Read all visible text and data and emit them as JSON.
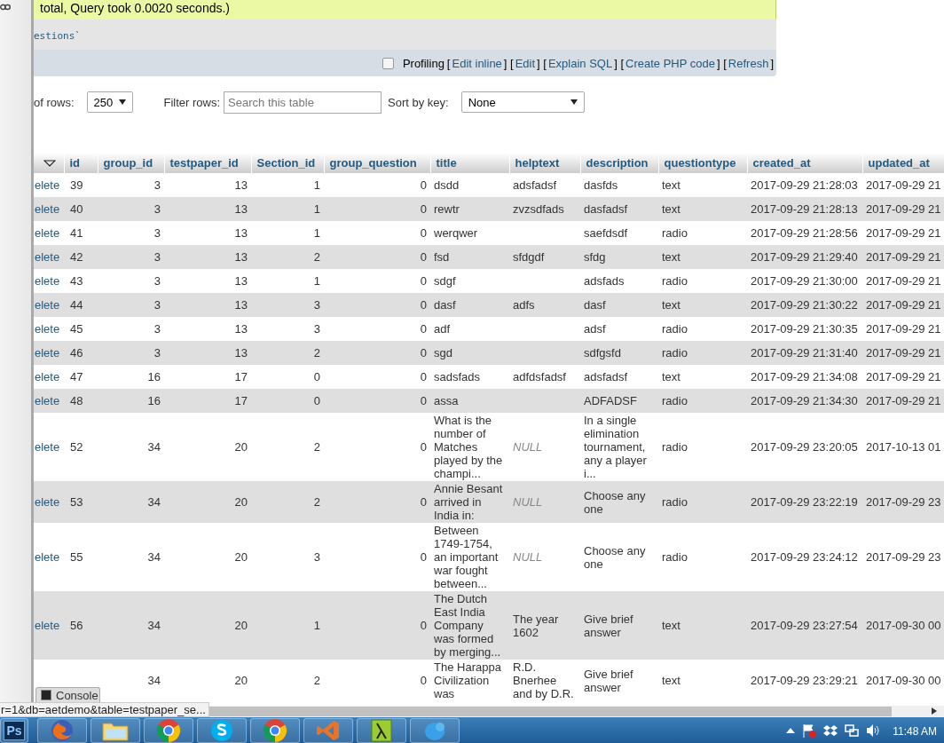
{
  "query_message": "total, Query took 0.0020 seconds.)",
  "sql_fragment": "estions`",
  "toolbar": {
    "profiling": {
      "label": "Profiling",
      "checked": false
    },
    "actions": [
      {
        "kind": "bracket",
        "text": "["
      },
      {
        "kind": "link",
        "text": "Edit inline"
      },
      {
        "kind": "bracket",
        "text": "] ["
      },
      {
        "kind": "link",
        "text": "Edit"
      },
      {
        "kind": "bracket",
        "text": "] ["
      },
      {
        "kind": "link",
        "text": "Explain SQL"
      },
      {
        "kind": "bracket",
        "text": "] ["
      },
      {
        "kind": "link",
        "text": "Create PHP code"
      },
      {
        "kind": "bracket",
        "text": "] ["
      },
      {
        "kind": "link",
        "text": "Refresh"
      },
      {
        "kind": "bracket",
        "text": "]"
      }
    ]
  },
  "controls": {
    "rows_label": "of rows:",
    "rows_value": "250",
    "filter_label": "Filter rows:",
    "filter_placeholder": "Search this table",
    "sort_label": "Sort by key:",
    "sort_value": "None"
  },
  "table": {
    "columns": [
      {
        "label": "id"
      },
      {
        "label": "group_id"
      },
      {
        "label": "testpaper_id"
      },
      {
        "label": "Section_id"
      },
      {
        "label": "group_question"
      },
      {
        "label": "title"
      },
      {
        "label": "helptext"
      },
      {
        "label": "description"
      },
      {
        "label": "questiontype"
      },
      {
        "label": "created_at"
      },
      {
        "label": "updated_at"
      }
    ],
    "rows": [
      {
        "action": "elete",
        "cells": [
          "39",
          "3",
          "13",
          "1",
          "0",
          "dsdd",
          "adsfadsf",
          "dasfds",
          "text",
          "2017-09-29 21:28:03",
          "2017-09-29 21"
        ]
      },
      {
        "action": "elete",
        "cells": [
          "40",
          "3",
          "13",
          "1",
          "0",
          "rewtr",
          "zvzsdfads",
          "dasfadsf",
          "text",
          "2017-09-29 21:28:13",
          "2017-09-29 21"
        ]
      },
      {
        "action": "elete",
        "cells": [
          "41",
          "3",
          "13",
          "1",
          "0",
          "werqwer",
          null,
          "saefdsdf",
          "radio",
          "2017-09-29 21:28:56",
          "2017-09-29 21"
        ]
      },
      {
        "action": "elete",
        "cells": [
          "42",
          "3",
          "13",
          "2",
          "0",
          "fsd",
          "sfdgdf",
          "sfdg",
          "text",
          "2017-09-29 21:29:40",
          "2017-09-29 21"
        ]
      },
      {
        "action": "elete",
        "cells": [
          "43",
          "3",
          "13",
          "1",
          "0",
          "sdgf",
          null,
          "adsfads",
          "radio",
          "2017-09-29 21:30:00",
          "2017-09-29 21"
        ]
      },
      {
        "action": "elete",
        "cells": [
          "44",
          "3",
          "13",
          "3",
          "0",
          "dasf",
          "adfs",
          "dasf",
          "text",
          "2017-09-29 21:30:22",
          "2017-09-29 21"
        ]
      },
      {
        "action": "elete",
        "cells": [
          "45",
          "3",
          "13",
          "3",
          "0",
          "adf",
          null,
          "adsf",
          "radio",
          "2017-09-29 21:30:35",
          "2017-09-29 21"
        ]
      },
      {
        "action": "elete",
        "cells": [
          "46",
          "3",
          "13",
          "2",
          "0",
          "sgd",
          null,
          "sdfgsfd",
          "radio",
          "2017-09-29 21:31:40",
          "2017-09-29 21"
        ]
      },
      {
        "action": "elete",
        "cells": [
          "47",
          "16",
          "17",
          "0",
          "0",
          "sadsfads",
          "adfdsfadsf",
          "adsfadsf",
          "text",
          "2017-09-29 21:34:08",
          "2017-09-29 21"
        ]
      },
      {
        "action": "elete",
        "cells": [
          "48",
          "16",
          "17",
          "0",
          "0",
          "assa",
          null,
          "ADFADSF",
          "radio",
          "2017-09-29 21:34:30",
          "2017-09-29 21"
        ]
      },
      {
        "action": "elete",
        "cells": [
          "52",
          "34",
          "20",
          "2",
          "0",
          "What is the number of Matches played by the champi...",
          {
            "text": "NULL",
            "kind": "null"
          },
          "In a single elimination tournament, any a player i...",
          "radio",
          "2017-09-29 23:20:05",
          "2017-10-13 01"
        ]
      },
      {
        "action": "elete",
        "cells": [
          "53",
          "34",
          "20",
          "2",
          "0",
          "Annie Besant arrived in India in:",
          {
            "text": "NULL",
            "kind": "null"
          },
          "Choose any one",
          "radio",
          "2017-09-29 23:22:19",
          "2017-09-29 23"
        ]
      },
      {
        "action": "elete",
        "cells": [
          "55",
          "34",
          "20",
          "3",
          "0",
          "Between 1749-1754, an important war fought between...",
          {
            "text": "NULL",
            "kind": "null"
          },
          "Choose any one",
          "radio",
          "2017-09-29 23:24:12",
          "2017-09-29 23"
        ]
      },
      {
        "action": "elete",
        "cells": [
          "56",
          "34",
          "20",
          "1",
          "0",
          "The Dutch East India Company was formed by merging...",
          "The year 1602",
          "Give brief answer",
          "text",
          "2017-09-29 23:27:54",
          "2017-09-30 00"
        ]
      },
      {
        "cells": [
          null,
          "34",
          "20",
          "2",
          "0",
          "The Harappa Civilization was",
          "R.D. Bnerhee and by D.R.",
          "Give brief answer",
          "text",
          "2017-09-29 23:29:21",
          "2017-09-30 00"
        ]
      }
    ]
  },
  "console": {
    "label": "Console"
  },
  "status_url": "r=1&db=aetdemo&table=testpaper_se...",
  "taskbar": {
    "apps": [
      {
        "kind": "ps",
        "label": "Ps"
      },
      {
        "kind": "firefox"
      },
      {
        "kind": "folder"
      },
      {
        "kind": "chrome"
      },
      {
        "kind": "skype"
      },
      {
        "kind": "chrome"
      },
      {
        "kind": "vs"
      },
      {
        "kind": "lambda"
      },
      {
        "kind": "bird"
      }
    ],
    "time": "11:48 AM"
  }
}
